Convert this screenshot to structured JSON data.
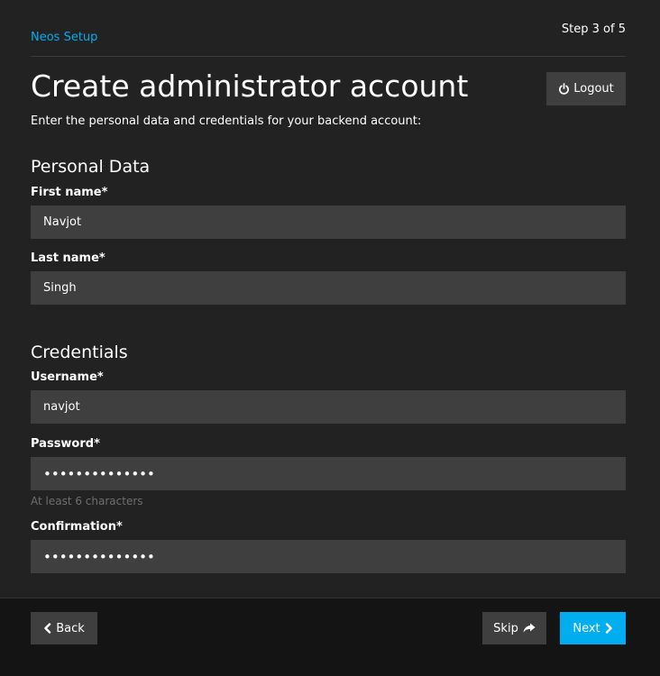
{
  "header": {
    "brand": "Neos Setup",
    "step": "Step 3 of 5"
  },
  "title": "Create administrator account",
  "logout_label": "Logout",
  "intro": "Enter the personal data and credentials for your backend account:",
  "personal": {
    "heading": "Personal Data",
    "first_name_label": "First name*",
    "first_name_value": "Navjot",
    "last_name_label": "Last name*",
    "last_name_value": "Singh"
  },
  "credentials": {
    "heading": "Credentials",
    "username_label": "Username*",
    "username_value": "navjot",
    "password_label": "Password*",
    "password_value": "••••••••••••••",
    "password_help": "At least 6 characters",
    "confirmation_label": "Confirmation*",
    "confirmation_value": "••••••••••••••"
  },
  "footer": {
    "back_label": "Back",
    "skip_label": "Skip",
    "next_label": "Next"
  },
  "icons": {
    "logout": "power-icon",
    "back": "chevron-left-icon",
    "skip": "share-arrow-icon",
    "next": "chevron-right-icon"
  },
  "colors": {
    "accent": "#00adee",
    "background": "#222222",
    "input": "#3f3f3f",
    "footer": "#141414"
  }
}
